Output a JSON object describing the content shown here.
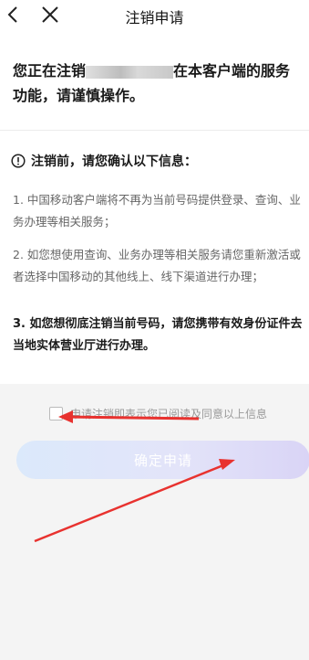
{
  "header": {
    "title": "注销申请",
    "back_icon": "chevron-left-icon",
    "close_icon": "close-icon"
  },
  "warning": {
    "prefix": "您正在注销",
    "suffix": "在本客户端的服务功能，请谨慎操作。"
  },
  "notice": {
    "icon": "info-icon",
    "heading": "注销前，请您确认以下信息：",
    "items": [
      "1. 中国移动客户端将不再为当前号码提供登录、查询、业务办理等相关服务；",
      "2. 如您想使用查询、业务办理等相关服务请您重新激活或者选择中国移动的其他线上、线下渠道进行办理；",
      "3. 如您想彻底注销当前号码，请您携带有效身份证件去当地实体营业厅进行办理。"
    ]
  },
  "agreement": {
    "label": "申请注销即表示您已阅读及同意以上信息",
    "checked": false
  },
  "submit": {
    "label": "确定申请"
  },
  "colors": {
    "annotation_arrow": "#e8322f",
    "button_start": "#dbe9fb",
    "button_end": "#d9d4f6"
  }
}
